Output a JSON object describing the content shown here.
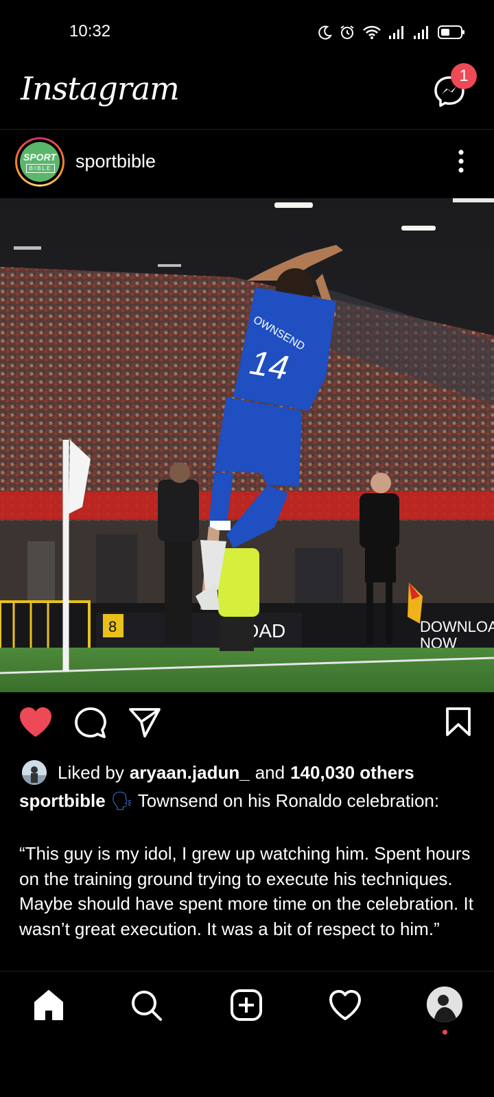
{
  "status_bar": {
    "time": "10:32",
    "icons": [
      "moon-icon",
      "alarm-icon",
      "wifi-icon",
      "signal-icon",
      "signal-icon",
      "battery-icon"
    ]
  },
  "header": {
    "logo_text": "Instagram",
    "messenger_badge_count": "1"
  },
  "post": {
    "username": "sportbible",
    "avatar_text_top": "SPORT",
    "avatar_text_bottom": "BIBLE",
    "image": {
      "shirt_name": "OWNSEND",
      "shirt_number": "14",
      "board_text_1": "LOAD",
      "board_text_2": "DOWNLOAD",
      "board_text_3": "NOW",
      "sign_number": "8"
    },
    "likes": {
      "prefix": "Liked by",
      "liker": "aryaan.jadun_",
      "connector": "and",
      "others": "140,030 others"
    },
    "caption": {
      "username": "sportbible",
      "emoji": "🗣",
      "first_line": "Townsend on his Ronaldo celebration:",
      "quote": "“This guy is my idol, I grew up watching him. Spent hours on the training ground trying to execute his techniques. Maybe should have spent more time on the celebration. It wasn’t great execution. It was a bit of respect to him.”"
    }
  },
  "colors": {
    "background": "#000000",
    "like_red": "#ed4956",
    "kit_blue": "#1f4fc0",
    "pitch_green": "#3f7a2f"
  },
  "bottom_nav": {
    "items": [
      "home-icon",
      "search-icon",
      "new-post-icon",
      "activity-icon",
      "profile-avatar"
    ]
  }
}
